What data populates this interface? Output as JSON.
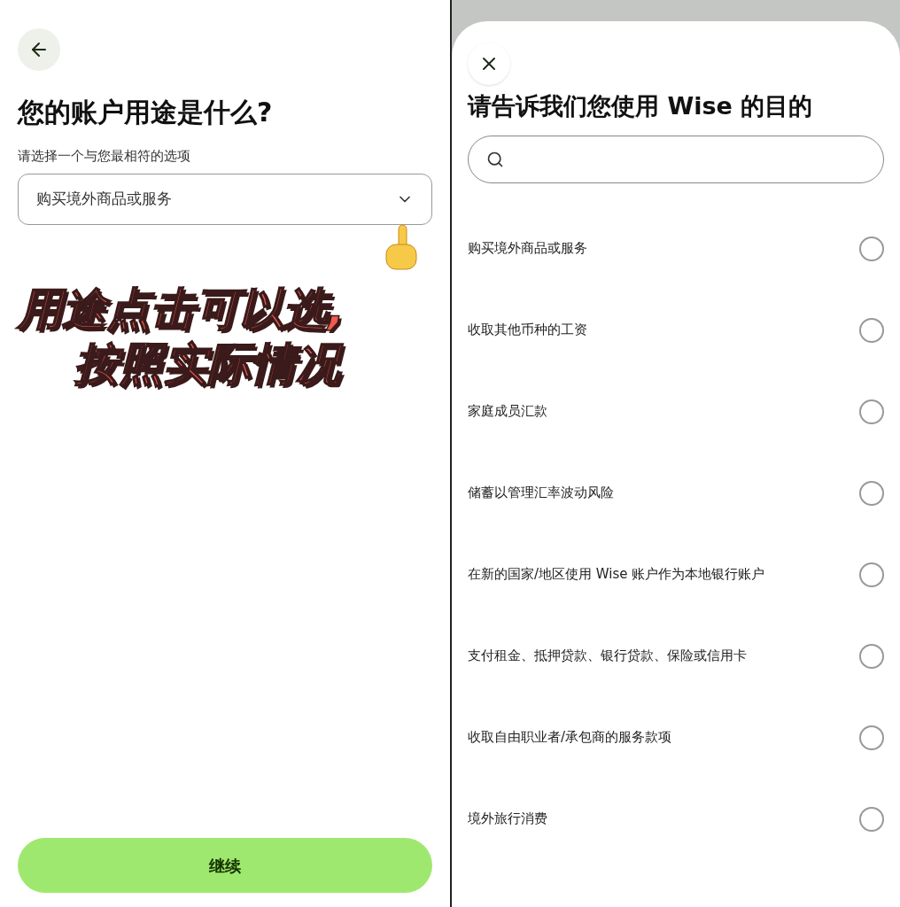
{
  "left_screen": {
    "title": "您的账户用途是什么?",
    "select_label": "请选择一个与您最相符的选项",
    "select_value": "购买境外商品或服务",
    "continue_button": "继续",
    "annotation": [
      "用途点击可以选,",
      "按照实际情况"
    ]
  },
  "right_screen": {
    "title": "请告诉我们您使用 Wise 的目的",
    "options": [
      {
        "label": "购买境外商品或服务",
        "selected": false
      },
      {
        "label": "收取其他币种的工资",
        "selected": false
      },
      {
        "label": "家庭成员汇款",
        "selected": false
      },
      {
        "label": "储蓄以管理汇率波动风险",
        "selected": false
      },
      {
        "label": "在新的国家/地区使用 Wise 账户作为本地银行账户",
        "selected": false
      },
      {
        "label": "支付租金、抵押贷款、银行贷款、保险或信用卡",
        "selected": false
      },
      {
        "label": "收取自由职业者/承包商的服务款项",
        "selected": false
      },
      {
        "label": "境外旅行消费",
        "selected": false
      }
    ]
  }
}
